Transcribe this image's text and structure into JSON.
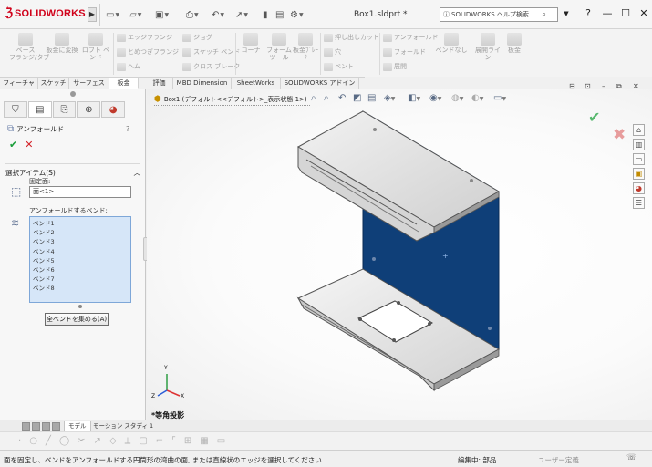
{
  "app": {
    "logo_text": "SOLIDWORKS",
    "document_title": "Box1.sldprt *",
    "search_placeholder": "SOLIDWORKS ヘルプ検索",
    "search_icon": "search-icon"
  },
  "window_controls": [
    "?",
    "—",
    "☐",
    "✕"
  ],
  "ribbon": {
    "items": [
      {
        "label": "ベース\nフランジ/タブ"
      },
      {
        "label": "板金に変換"
      },
      {
        "label": "ロフト ベンド"
      },
      {
        "label": "コーナー"
      },
      {
        "label": "フォーム\nツール"
      },
      {
        "label": "板金ﾌﾞﾚｰｸ"
      },
      {
        "label": "ベンドなし"
      },
      {
        "label": "展開ライン"
      },
      {
        "label": "板金"
      }
    ],
    "rows": [
      {
        "label": "エッジフランジ"
      },
      {
        "label": "ジョグ"
      },
      {
        "label": "とめつぎフランジ"
      },
      {
        "label": "スケッチ ベンド"
      },
      {
        "label": "ヘム"
      },
      {
        "label": "クロス ブレーク"
      },
      {
        "label": "押し出しカット"
      },
      {
        "label": "穴"
      },
      {
        "label": "ベント"
      },
      {
        "label": "アンフォールド"
      },
      {
        "label": "フォールド"
      },
      {
        "label": "展開"
      }
    ]
  },
  "command_tabs": [
    "フィーチャー",
    "スケッチ",
    "サーフェス",
    "板金",
    "評価",
    "MBD Dimension",
    "SheetWorks",
    "SOLIDWORKS アドイン"
  ],
  "property_manager": {
    "title": "アンフォールド",
    "help": "?",
    "section_title": "選択アイテム(S)",
    "fixed_face_label": "固定面:",
    "fixed_face_value": "面<1>",
    "bends_label": "アンフォールドするベンド:",
    "bends": [
      "ベンド1",
      "ベンド2",
      "ベンド3",
      "ベンド4",
      "ベンド5",
      "ベンド6",
      "ベンド7",
      "ベンド8"
    ],
    "collect_button": "全ベンドを集める(A)"
  },
  "viewport": {
    "tree_item": "Box1 (デフォルト<<デフォルト>_表示状態 1>)",
    "view_orientation": "*等角投影",
    "axis_labels": {
      "x": "X",
      "y": "Y",
      "z": "Z"
    }
  },
  "bottom_tabs": [
    "モデル",
    "モーション スタディ 1"
  ],
  "status_bar": {
    "message": "面を固定し、ベンドをアンフォールドする円筒形の湾曲の面, または直線状のエッジを選択してください",
    "editing": "編集中: 部品",
    "units": "ユーザー定義"
  },
  "colors": {
    "brand": "#d0021b",
    "selected_face": "#0f3f78",
    "list_bg": "#d6e6f8",
    "ok_green": "#1b9e3a",
    "cancel_red": "#d31e25"
  }
}
